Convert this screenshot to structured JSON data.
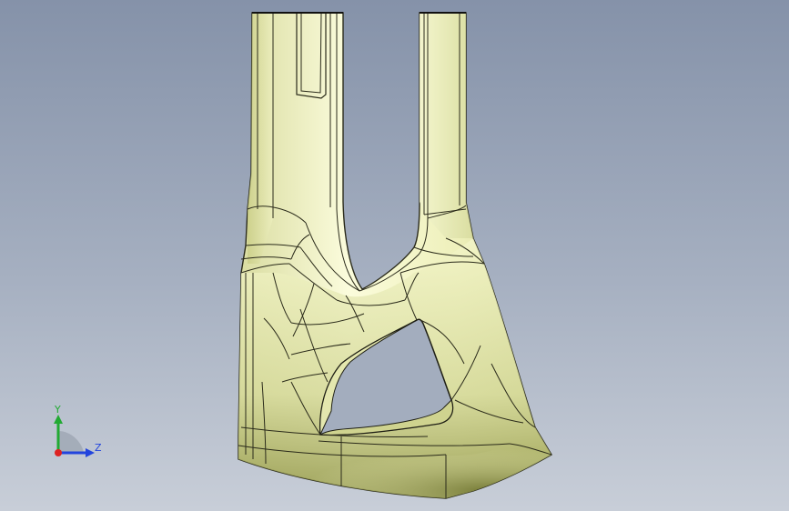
{
  "viewport": {
    "background_top": "#8592a9",
    "background_bottom": "#c8ced8"
  },
  "model": {
    "shape": "fork-shaped solid part",
    "face_color": "#f2f4c4",
    "shade_color": "#9aa04e",
    "edge_color": "#2a2a1a"
  },
  "triad": {
    "y_label": "Y",
    "z_label": "Z",
    "y_color": "#22aa33",
    "z_color": "#2244dd",
    "origin_color": "#dd2222"
  }
}
